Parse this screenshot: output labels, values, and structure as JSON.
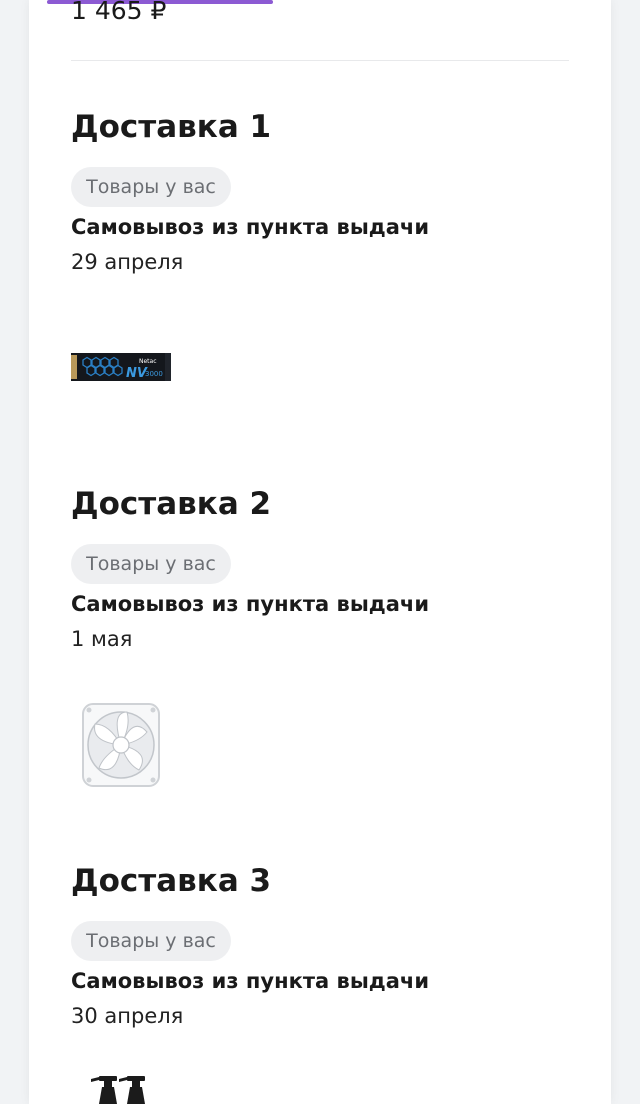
{
  "order": {
    "total_price": "1 465 ₽"
  },
  "deliveries": [
    {
      "title": "Доставка 1",
      "chip": "Товары у вас",
      "method": "Самовывоз из пункта выдачи",
      "date": "29 апреля",
      "product_image": "ssd-m2-product-image"
    },
    {
      "title": "Доставка 2",
      "chip": "Товары у вас",
      "method": "Самовывоз из пункта выдачи",
      "date": "1 мая",
      "product_image": "fan-product-image"
    },
    {
      "title": "Доставка 3",
      "chip": "Товары у вас",
      "method": "Самовывоз из пункта выдачи",
      "date": "30 апреля",
      "product_image": "spray-bottles-product-image"
    }
  ],
  "colors": {
    "accent": "#8c5ad3",
    "chip_bg": "#eeeff1",
    "chip_text": "#6b6e73"
  }
}
